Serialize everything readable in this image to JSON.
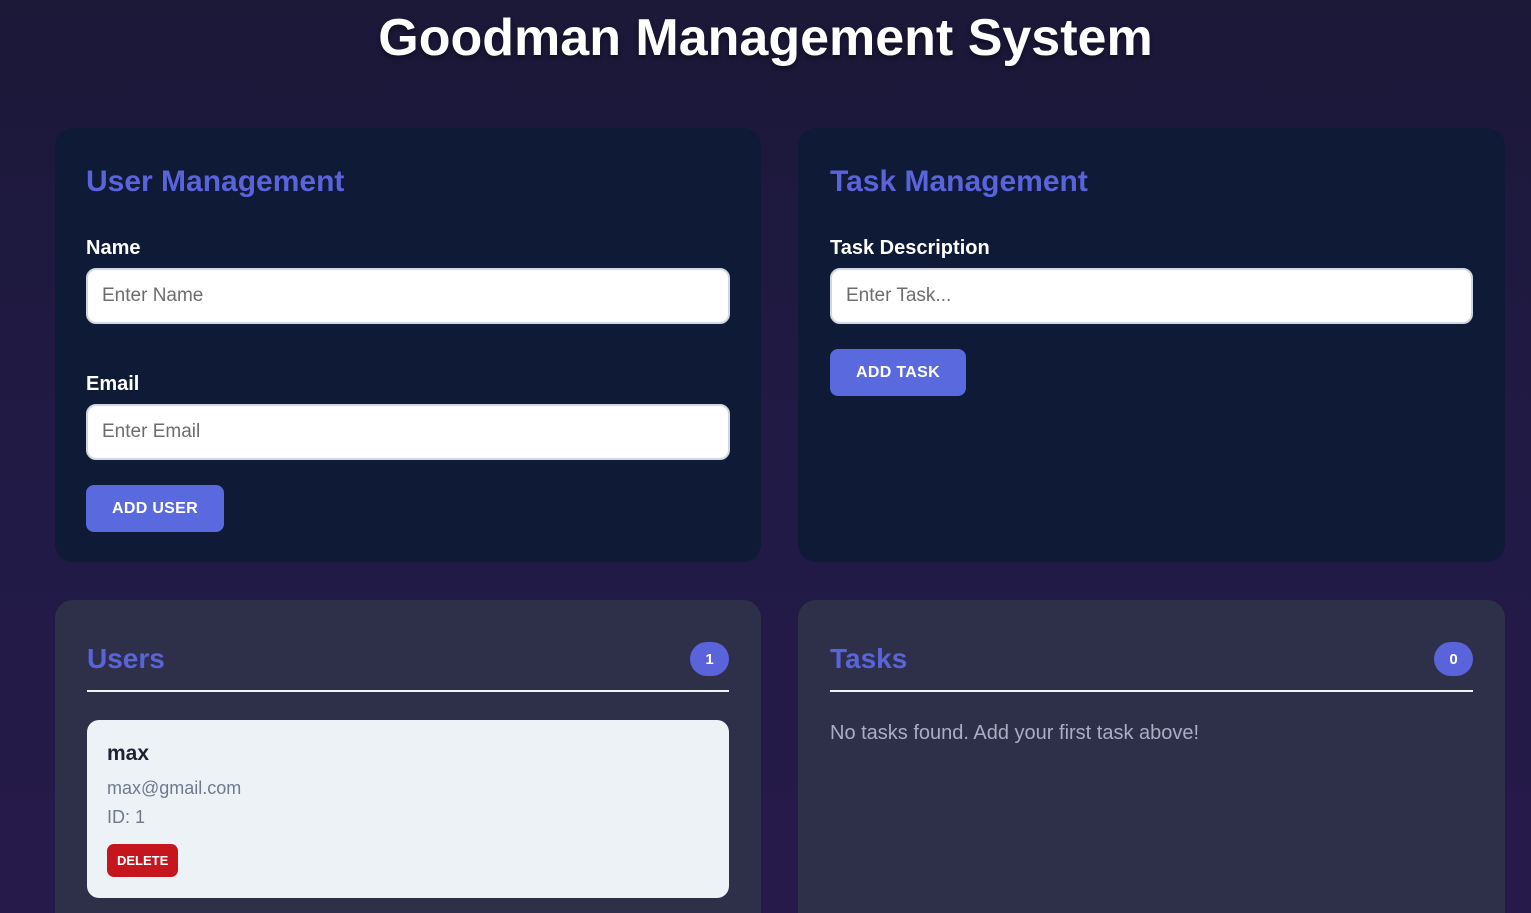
{
  "app": {
    "title": "Goodman Management System"
  },
  "user_management": {
    "title": "User Management",
    "name_label": "Name",
    "name_placeholder": "Enter Name",
    "name_value": "",
    "email_label": "Email",
    "email_placeholder": "Enter Email",
    "email_value": "",
    "add_button": "ADD USER"
  },
  "task_management": {
    "title": "Task Management",
    "description_label": "Task Description",
    "description_placeholder": "Enter Task...",
    "description_value": "",
    "add_button": "ADD TASK"
  },
  "users_list": {
    "title": "Users",
    "count": "1",
    "items": [
      {
        "name": "max",
        "email": "max@gmail.com",
        "id": "ID: 1",
        "delete_label": "DELETE"
      }
    ]
  },
  "tasks_list": {
    "title": "Tasks",
    "count": "0",
    "empty_message": "No tasks found. Add your first task above!"
  },
  "colors": {
    "accent": "#5b63db",
    "button": "#5b69de",
    "danger": "#c4161c",
    "form_card": "#0e1a36",
    "list_card": "#2d3048"
  }
}
